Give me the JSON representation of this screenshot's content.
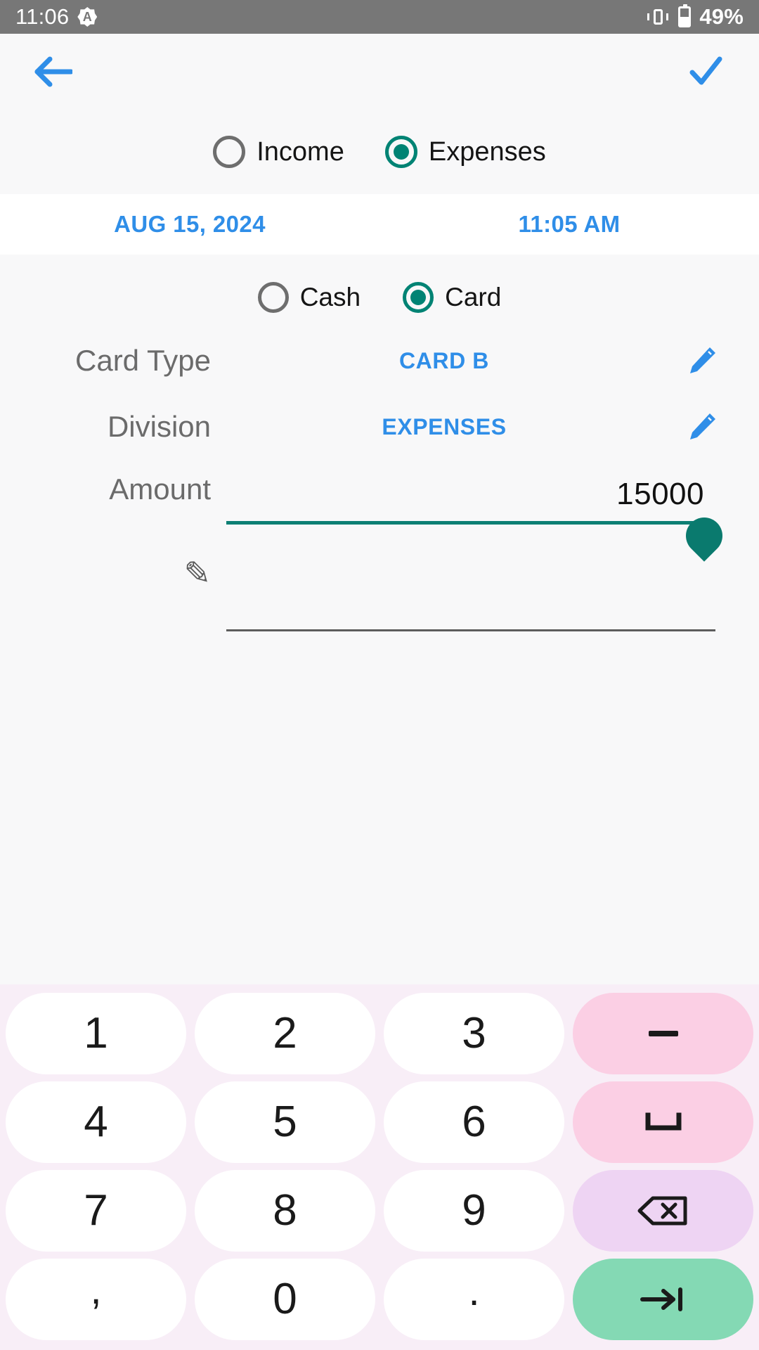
{
  "statusbar": {
    "time": "11:06",
    "badge_icon": "A",
    "battery_percent": "49%",
    "vibrate_icon": "vibrate-icon",
    "battery_icon": "battery-icon"
  },
  "appbar": {
    "back_icon": "back-arrow-icon",
    "confirm_icon": "check-icon",
    "accent_color": "#2f8ee8"
  },
  "transaction_type": {
    "options": [
      {
        "label": "Income",
        "selected": false
      },
      {
        "label": "Expenses",
        "selected": true
      }
    ]
  },
  "datetime": {
    "date": "AUG 15, 2024",
    "time": "11:05 AM"
  },
  "payment_method": {
    "options": [
      {
        "label": "Cash",
        "selected": false
      },
      {
        "label": "Card",
        "selected": true
      }
    ]
  },
  "fields": {
    "card_type": {
      "label": "Card Type",
      "value": "CARD B",
      "edit_icon": "pencil-icon"
    },
    "division": {
      "label": "Division",
      "value": "EXPENSES",
      "edit_icon": "pencil-icon"
    },
    "amount": {
      "label": "Amount",
      "value": "15000"
    },
    "note": {
      "icon": "pencil-outline-icon",
      "value": ""
    }
  },
  "colors": {
    "accent_blue": "#2f8ee8",
    "accent_teal": "#008374",
    "label_gray": "#6b6b6b",
    "statusbar_gray": "#777777"
  },
  "keyboard": {
    "rows": [
      [
        {
          "label": "1",
          "type": "digit"
        },
        {
          "label": "2",
          "type": "digit"
        },
        {
          "label": "3",
          "type": "digit"
        },
        {
          "label": "–",
          "type": "minus",
          "name": "minus-key"
        }
      ],
      [
        {
          "label": "4",
          "type": "digit"
        },
        {
          "label": "5",
          "type": "digit"
        },
        {
          "label": "6",
          "type": "digit"
        },
        {
          "label": "⌴",
          "type": "space",
          "name": "space-key"
        }
      ],
      [
        {
          "label": "7",
          "type": "digit"
        },
        {
          "label": "8",
          "type": "digit"
        },
        {
          "label": "9",
          "type": "digit"
        },
        {
          "label": "",
          "type": "backspace",
          "name": "backspace-key"
        }
      ],
      [
        {
          "label": ",",
          "type": "comma"
        },
        {
          "label": "0",
          "type": "digit"
        },
        {
          "label": ".",
          "type": "dot"
        },
        {
          "label": "",
          "type": "next",
          "name": "next-key"
        }
      ]
    ]
  }
}
